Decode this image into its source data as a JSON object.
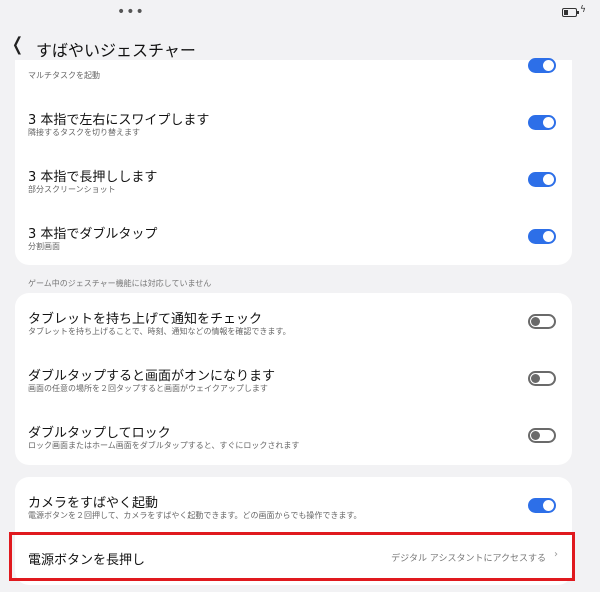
{
  "status": {
    "dots": "•••"
  },
  "header": {
    "title": "すばやいジェスチャー"
  },
  "group1": {
    "partial_sub": "マルチタスクを起動",
    "items": [
      {
        "title": "3 本指で左右にスワイプします",
        "sub": "隣接するタスクを切り替えます",
        "state": "on"
      },
      {
        "title": "3 本指で長押しします",
        "sub": "部分スクリーンショット",
        "state": "on"
      },
      {
        "title": "3 本指でダブルタップ",
        "sub": "分割画面",
        "state": "on"
      }
    ]
  },
  "note": "ゲーム中のジェスチャー機能には対応していません",
  "group2": {
    "items": [
      {
        "title": "タブレットを持ち上げて通知をチェック",
        "sub": "タブレットを持ち上げることで、時刻、通知などの情報を確認できます。",
        "state": "off"
      },
      {
        "title": "ダブルタップすると画面がオンになります",
        "sub": "画面の任意の場所を２回タップすると画面がウェイクアップします",
        "state": "off"
      },
      {
        "title": "ダブルタップしてロック",
        "sub": "ロック画面またはホーム画面をダブルタップすると、すぐにロックされます",
        "state": "off"
      }
    ]
  },
  "group3": {
    "camera": {
      "title": "カメラをすばやく起動",
      "sub": "電源ボタンを２回押して、カメラをすばやく起動できます。どの画面からでも操作できます。",
      "state": "on"
    },
    "power": {
      "title": "電源ボタンを長押し",
      "value": "デジタル アシスタントにアクセスする"
    }
  },
  "colors": {
    "accent": "#2d6fe8",
    "highlight": "#e0191e"
  }
}
